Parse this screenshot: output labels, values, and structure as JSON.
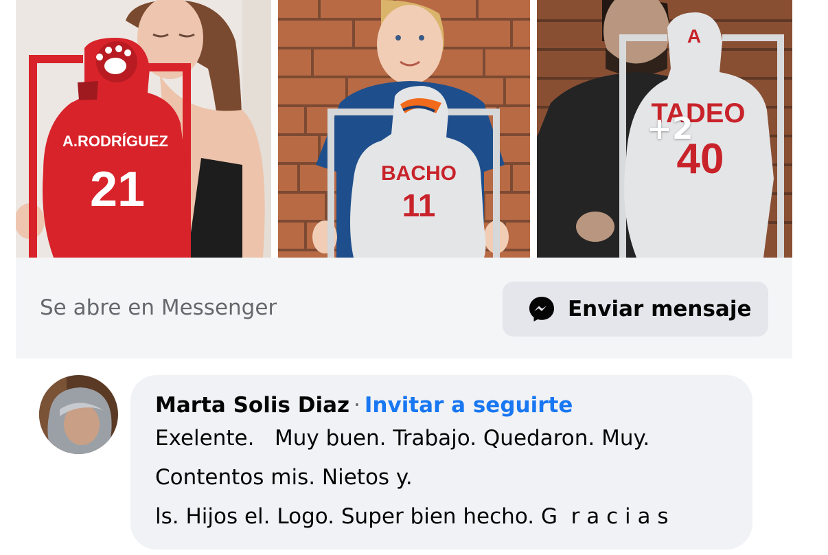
{
  "post_card": {
    "photos": [
      {
        "name_on_jersey": "A.RODRÍGUEZ",
        "number": "21"
      },
      {
        "name_on_jersey": "BACHO",
        "number": "11"
      },
      {
        "name_on_jersey": "TADEO",
        "number": "40",
        "helmet_letter": "A",
        "more_count": "+2"
      }
    ],
    "cta": {
      "text": "Se abre en Messenger",
      "button_label": "Enviar mensaje",
      "button_icon": "messenger-icon"
    }
  },
  "comment": {
    "author": "Marta Solis Diaz",
    "separator": "·",
    "follow_label": "Invitar a seguirte",
    "lines": [
      "Exelente.   Muy buen. Trabajo. Quedaron. Muy.",
      "Contentos mis. Nietos y.",
      "ls. Hijos el. Logo. Super bien hecho. G  r a c i a s"
    ]
  },
  "colors": {
    "cta_bg": "#f4f5f7",
    "button_bg": "#e4e6eb",
    "bubble_bg": "#f0f2f5",
    "link_blue": "#1877f2",
    "jersey_red": "#d8232a",
    "jersey_white": "#e4e5e7"
  }
}
